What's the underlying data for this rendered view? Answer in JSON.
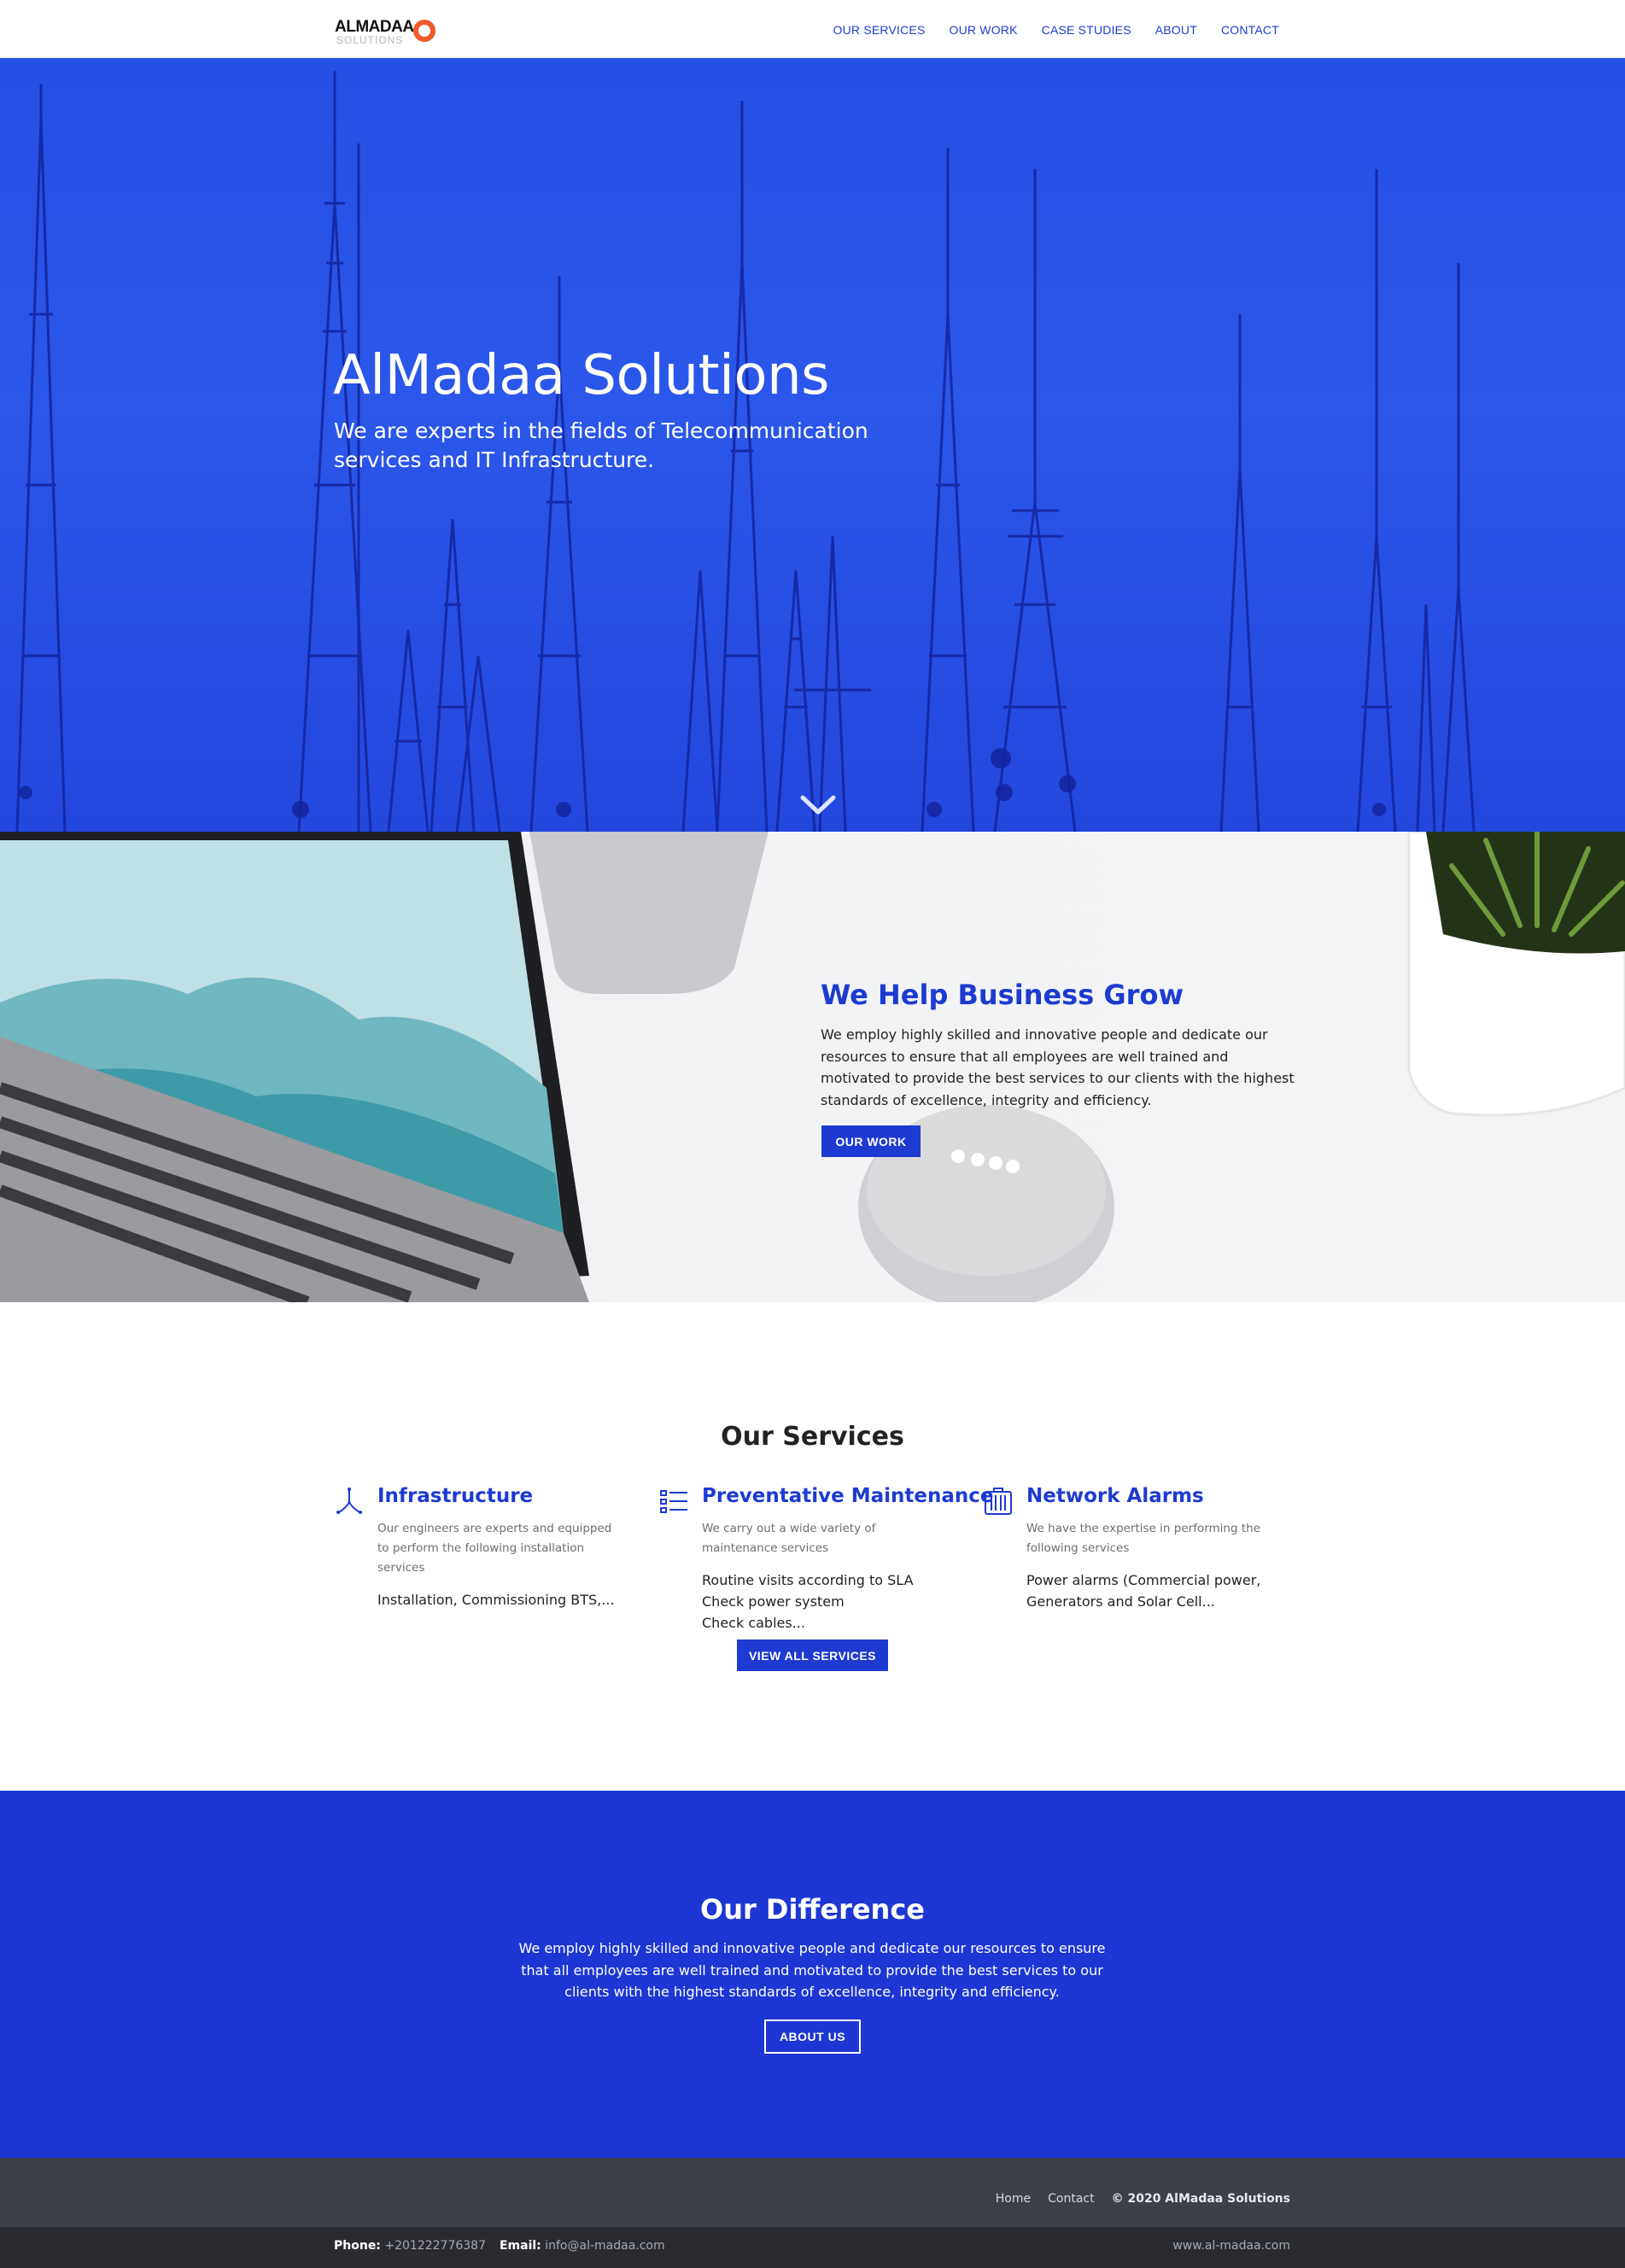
{
  "brand": {
    "logo_main": "ALMADAA",
    "logo_sub": "SOLUTIONS",
    "accent": "#1d3bd1",
    "logo_ring_color": "#ef5a2a"
  },
  "nav": {
    "items": [
      {
        "label": "OUR SERVICES"
      },
      {
        "label": "OUR WORK"
      },
      {
        "label": "CASE STUDIES"
      },
      {
        "label": "ABOUT"
      },
      {
        "label": "CONTACT"
      }
    ]
  },
  "hero": {
    "title": "AlMadaa Solutions",
    "subtitle": "We are experts in the fields of Telecommunication services and IT Infrastructure.",
    "background_color": "#2450e6",
    "scroll_icon": "chevron-down-icon"
  },
  "grow": {
    "title": "We Help Business Grow",
    "text": "We employ highly skilled and innovative people and dedicate our resources to ensure that all employees are well trained and motivated to provide the best services to our clients with the highest standards of excellence, integrity and efficiency.",
    "button_label": "OUR WORK"
  },
  "services": {
    "title": "Our Services",
    "items": [
      {
        "icon": "network-branch-icon",
        "title": "Infrastructure",
        "desc": "Our engineers are experts and equipped to perform the following installation services",
        "list": [
          "Installation, Commissioning BTS,..."
        ]
      },
      {
        "icon": "checklist-icon",
        "title": "Preventative Maintenance",
        "desc": "We carry out a wide variety of maintenance services",
        "list": [
          "Routine visits according to SLA",
          "Check power system",
          "Check cables..."
        ]
      },
      {
        "icon": "server-rack-icon",
        "title": "Network Alarms",
        "desc": "We have the expertise in performing the following services",
        "list": [
          "Power alarms (Commercial power, Generators and Solar Cell..."
        ]
      }
    ],
    "button_label": "VIEW ALL SERVICES"
  },
  "difference": {
    "title": "Our Difference",
    "text": "We employ highly skilled and innovative people and dedicate our resources to ensure that all employees are well trained and motivated to provide the best services to our clients with the highest standards of excellence, integrity and efficiency.",
    "button_label": "ABOUT US",
    "background_color": "#1c37d4"
  },
  "footer": {
    "links": [
      {
        "label": "Home"
      },
      {
        "label": "Contact"
      }
    ],
    "copyright": "© 2020 AlMadaa Solutions",
    "phone_label": "Phone:",
    "phone": "+201222776387",
    "email_label": "Email:",
    "email": "info@al-madaa.com",
    "website": "www.al-madaa.com"
  }
}
